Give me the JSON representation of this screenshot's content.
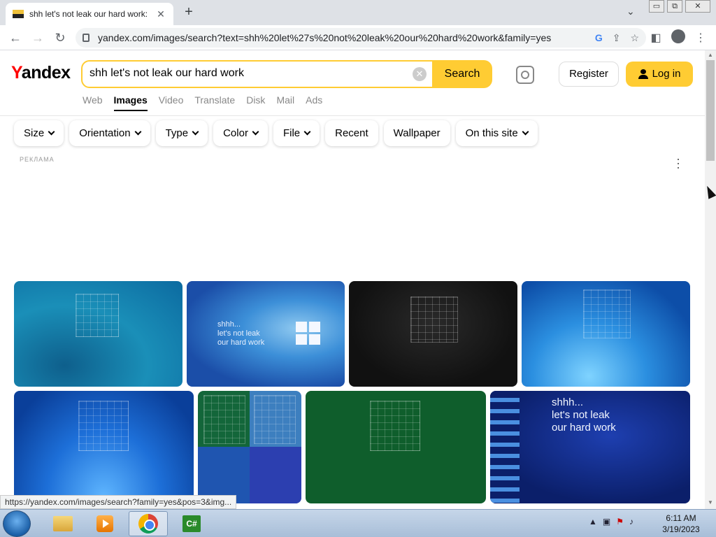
{
  "browser": {
    "tab_title": "shh let's not leak our hard work:",
    "tab_close": "✕",
    "new_tab": "+",
    "url": "yandex.com/images/search?text=shh%20let%27s%20not%20leak%20our%20hard%20work&family=yes",
    "window_controls": {
      "minimize": "▭",
      "restore": "⧉",
      "close": "✕"
    },
    "status_url": "https://yandex.com/images/search?family=yes&pos=3&img..."
  },
  "header": {
    "logo_y": "Y",
    "logo_rest": "andex",
    "search_value": "shh let's not leak our hard work",
    "search_button": "Search",
    "clear": "✕",
    "register": "Register",
    "login": "Log in"
  },
  "services": [
    {
      "label": "Web"
    },
    {
      "label": "Images",
      "active": true
    },
    {
      "label": "Video"
    },
    {
      "label": "Translate"
    },
    {
      "label": "Disk"
    },
    {
      "label": "Mail"
    },
    {
      "label": "Ads"
    }
  ],
  "filters": {
    "size": "Size",
    "orientation": "Orientation",
    "type": "Type",
    "color": "Color",
    "file": "File",
    "recent": "Recent",
    "wallpaper": "Wallpaper",
    "on_this_site": "On this site"
  },
  "ad_label": "РЕКЛАМА",
  "kebab": "⋮",
  "results": {
    "img2_caption": [
      "shhh...",
      "let's not leak",
      "our hard work"
    ],
    "img8_caption": [
      "shhh...",
      "let's not leak",
      "our hard work"
    ]
  },
  "taskbar": {
    "cs_icon_text": "C#",
    "time": "6:11 AM",
    "date": "3/19/2023",
    "tray_up": "▲"
  },
  "colors": {
    "accent": "#ffcc33",
    "logo_red": "#ff0000"
  }
}
